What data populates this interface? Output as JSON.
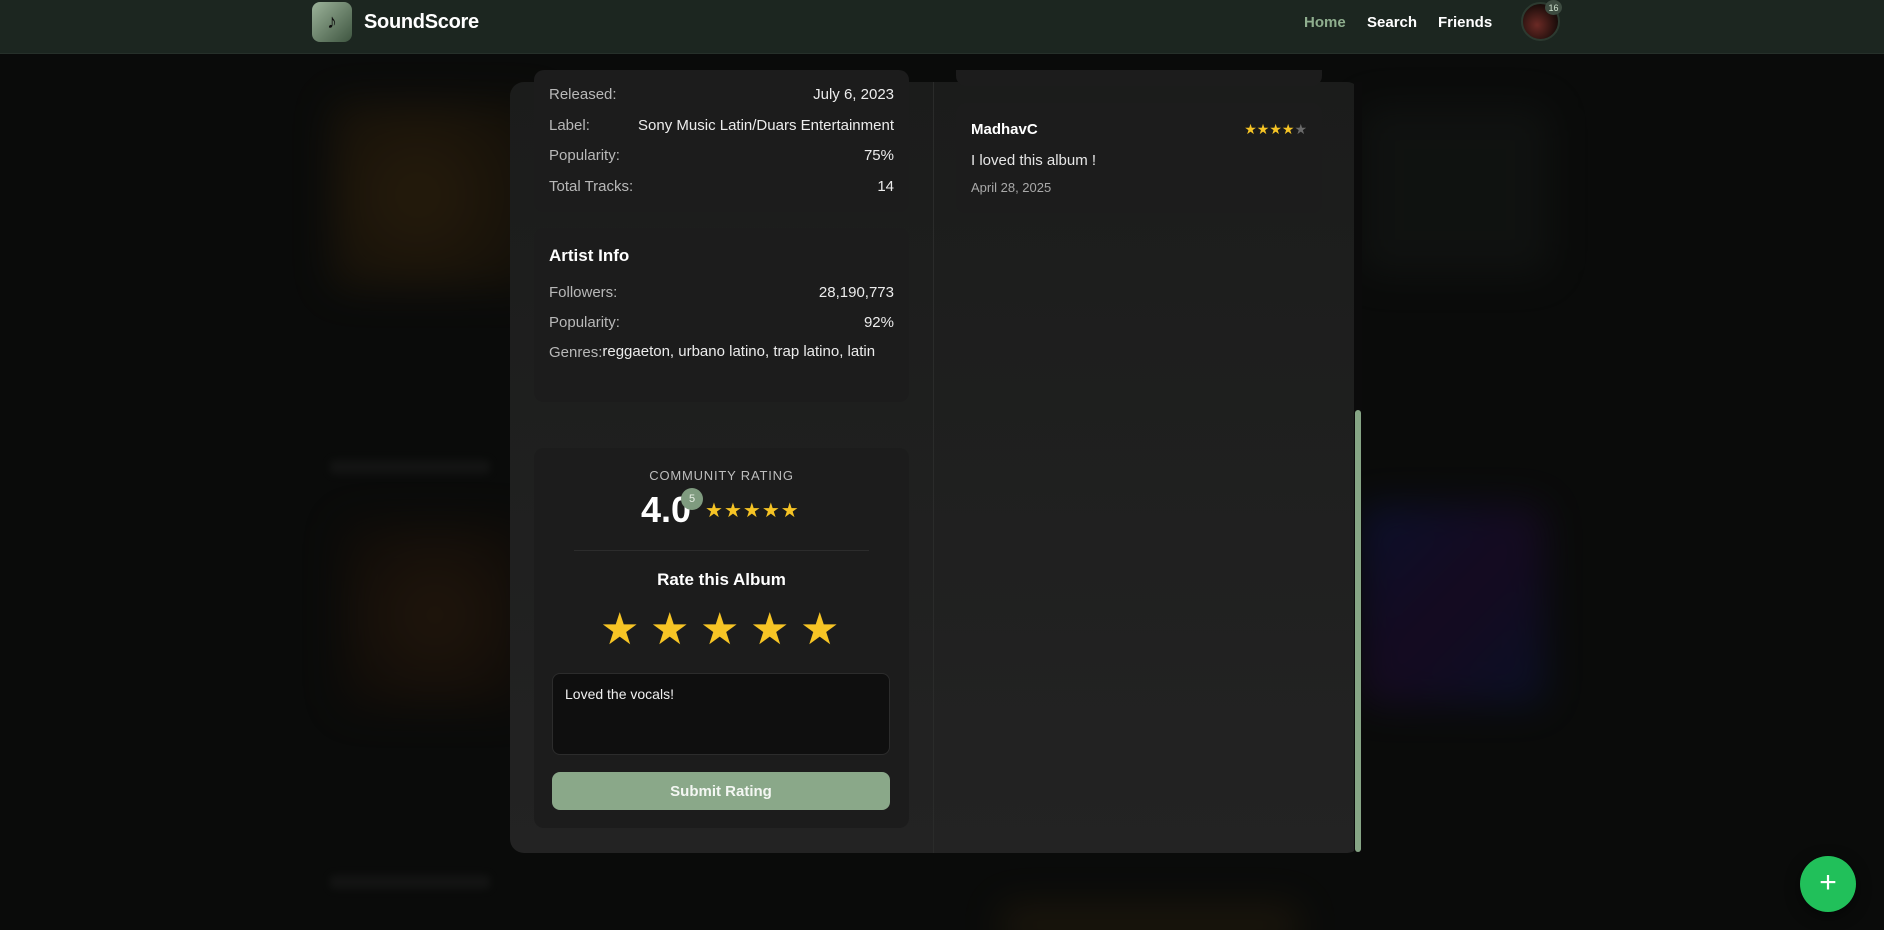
{
  "app": {
    "brand": "SoundScore",
    "logo_icon": "music-note-icon",
    "nav": {
      "home": "Home",
      "search": "Search",
      "friends": "Friends"
    },
    "avatar_badge": "16"
  },
  "album_details": {
    "released_label": "Released:",
    "released_value": "July 6, 2023",
    "label_label": "Label:",
    "label_value": "Sony Music Latin/Duars Entertainment",
    "popularity_label": "Popularity:",
    "popularity_value": "75%",
    "tracks_label": "Total Tracks:",
    "tracks_value": "14"
  },
  "artist_info": {
    "title": "Artist Info",
    "followers_label": "Followers:",
    "followers_value": "28,190,773",
    "popularity_label": "Popularity:",
    "popularity_value": "92%",
    "genres_label": "Genres:",
    "genres_value": "reggaeton, urbano latino, trap latino, latin"
  },
  "community": {
    "label": "COMMUNITY RATING",
    "score": "4.0",
    "rating_count": "5",
    "stars": "★★★★★"
  },
  "rate": {
    "title": "Rate this Album",
    "stars": [
      "★",
      "★",
      "★",
      "★",
      "★"
    ],
    "review_value": "Loved the vocals!",
    "submit_label": "Submit Rating"
  },
  "reviews": [
    {
      "user": "MadhavC",
      "stars_filled": "★★★★",
      "stars_empty": "★",
      "text": "I loved this album !",
      "date": "April 28, 2025"
    }
  ],
  "fab_label": "+",
  "colors": {
    "accent": "#8aa889",
    "star": "#f6c425",
    "fab": "#21c05a",
    "header": "#1c2620"
  }
}
